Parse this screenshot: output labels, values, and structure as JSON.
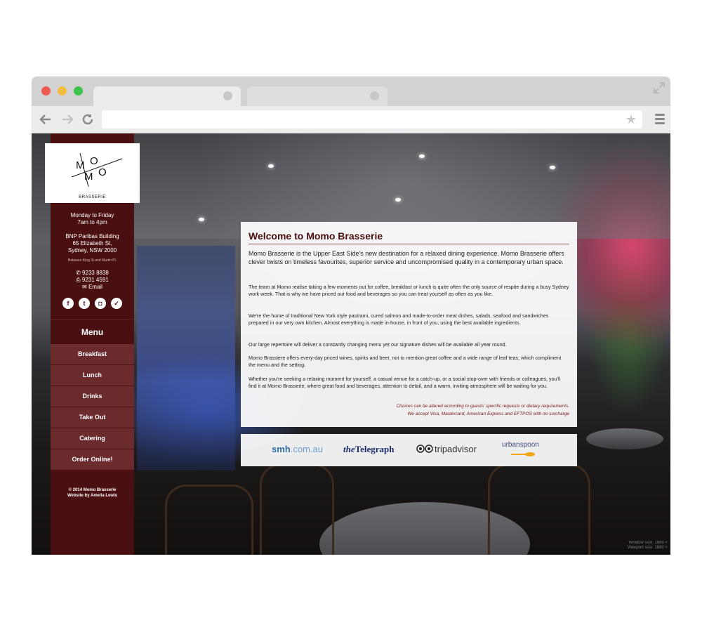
{
  "colors": {
    "sidebar": "#4a1011",
    "menu_item": "#6b2b2c",
    "heading": "#4a1011",
    "note": "#7a1414"
  },
  "browser": {
    "icons": [
      "close-dot",
      "minimize-dot",
      "maximize-dot",
      "expand-icon",
      "back-arrow-icon",
      "forward-arrow-icon",
      "reload-icon",
      "star-icon",
      "hamburger-menu-icon"
    ],
    "url": ""
  },
  "sidebar": {
    "logo_caption": "BRASSERIE",
    "hours": [
      "Monday to Friday",
      "7am to 4pm"
    ],
    "address": [
      "BNP Paribas Building",
      "65 Elizabeth St,",
      "Sydney, NSW 2000"
    ],
    "address_note": "Between King St and Martin Pl.",
    "phone": "9233 8838",
    "fax": "9231 4591",
    "email": "Email",
    "social_icons": [
      "facebook-icon",
      "twitter-icon",
      "instagram-icon",
      "foursquare-icon"
    ],
    "menu_heading": "Menu",
    "menu_items": [
      "Breakfast",
      "Lunch",
      "Drinks",
      "Take Out",
      "Catering",
      "Order Online!"
    ],
    "copyright": "© 2014 Momo Brasserie",
    "credit": "Website by Amelia Lewis"
  },
  "content": {
    "title": "Welcome to Momo Brasserie",
    "lead": "Momo Brasserie is the Upper East Side's new destination for a relaxed dining experience. Momo Brasserie offers clever twists on timeless favourites, superior service and uncompromised quality in a contemporary urban space.",
    "paragraphs": [
      "The team at Momo realise taking a few moments out for coffee, breakfast or lunch is quite often the only source of respite during a busy Sydney work week. That is why we have priced our food and beverages so you can treat yourself as often as you like.",
      "We're the home of traditional New York style pastrami, cured salmon and made-to-order meat dishes, salads, seafood and sandwiches prepared in our very own kitchen. Almost everything is made in-house, in front of you, using the best available ingredients.",
      "Our large repertoire will deliver a constantly changing menu yet our signature dishes will be available all year round.",
      "Momo Brassiere offers every-day priced wines, spirits and beer, not to mention great coffee and a wide range of leaf teas, which compliment the menu and the setting.",
      "Whether you're seeking a relaxing moment for yourself, a casual venue for a catch-up, or a social stop-over with friends or colleagues, you'll find it at Momo Brasserie, where great food and beverages, attention to detail, and a warm, inviting atmosphere will be waiting for you."
    ],
    "note1": "Choices can be altered according to guests' specific requests or dietary requirements.",
    "note2": "We accept Visa, Mastercard, American Express and EFTPOS with no surcharge"
  },
  "press": {
    "smh_a": "smh",
    "smh_b": ".com.au",
    "tel_a": "the",
    "tel_b": "Telegraph",
    "tripadvisor": "tripadvisor",
    "urbanspoon": "urbanspoon"
  },
  "overlay": {
    "window_size": "Window size:  1680 ×",
    "viewport_size": "Viewport size:  1680 ×"
  }
}
